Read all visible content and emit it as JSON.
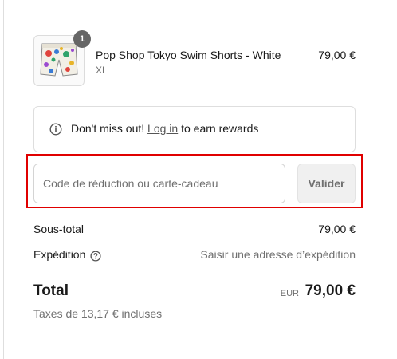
{
  "product": {
    "quantity": "1",
    "name": "Pop Shop Tokyo Swim Shorts - White",
    "variant": "XL",
    "price": "79,00 €"
  },
  "rewards_notice": {
    "prefix": "Don't miss out!",
    "link_label": "Log in",
    "suffix": "to earn rewards"
  },
  "discount": {
    "placeholder": "Code de réduction ou carte-cadeau",
    "value": "",
    "apply_label": "Valider"
  },
  "summary": {
    "subtotal_label": "Sous-total",
    "subtotal_value": "79,00 €",
    "shipping_label": "Expédition",
    "shipping_value": "Saisir une adresse d’expédition",
    "total_label": "Total",
    "total_currency": "EUR",
    "total_value": "79,00 €",
    "taxes_note": "Taxes de 13,17 € incluses"
  },
  "colors": {
    "highlight_border": "#e00000",
    "badge": "#666666",
    "muted_text": "#707070"
  },
  "icons": {
    "info": "info-icon",
    "help": "help-circle-icon"
  }
}
